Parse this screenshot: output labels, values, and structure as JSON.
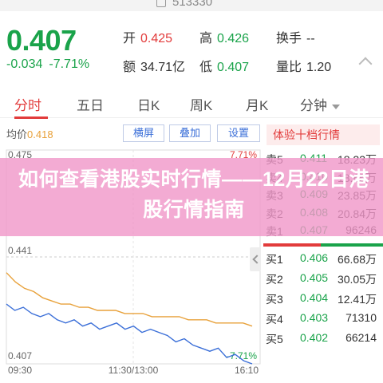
{
  "header": {
    "code": "513330"
  },
  "quote": {
    "price": "0.407",
    "change": "-0.034",
    "change_pct": "-7.71%",
    "open_label": "开",
    "open": "0.425",
    "high_label": "高",
    "high": "0.426",
    "turnover_label": "换手",
    "turnover": "--",
    "amount_label": "额",
    "amount": "34.71亿",
    "low_label": "低",
    "low": "0.407",
    "volume_ratio_label": "量比",
    "volume_ratio": "1.20"
  },
  "tabs": [
    {
      "label": "分时"
    },
    {
      "label": "五日"
    },
    {
      "label": "日K"
    },
    {
      "label": "周K"
    },
    {
      "label": "月K"
    },
    {
      "label": "分钟"
    }
  ],
  "chart_header": {
    "avg_label": "均价",
    "avg_value": "0.418",
    "btn_landscape": "横屏",
    "btn_overlay": "叠加",
    "btn_settings": "设置"
  },
  "chart_data": {
    "type": "line",
    "x_ticks": [
      "09:30",
      "11:30/13:00",
      "16:10"
    ],
    "y_ticks_left": [
      "0.475",
      "0.441",
      "0.407"
    ],
    "y_ticks_right": [
      "7.71%",
      "-7.71%"
    ],
    "ylim": [
      0.407,
      0.475
    ],
    "series": [
      {
        "values": [
          0.436,
          0.433,
          0.431,
          0.43,
          0.428,
          0.427,
          0.426,
          0.426,
          0.425,
          0.425,
          0.424,
          0.424,
          0.424,
          0.423,
          0.423,
          0.423,
          0.422,
          0.422,
          0.422,
          0.422,
          0.421,
          0.421,
          0.421,
          0.42,
          0.42,
          0.42,
          0.42,
          0.419
        ]
      },
      {
        "values": [
          0.426,
          0.424,
          0.425,
          0.423,
          0.422,
          0.423,
          0.421,
          0.42,
          0.421,
          0.419,
          0.42,
          0.418,
          0.419,
          0.42,
          0.418,
          0.419,
          0.417,
          0.418,
          0.417,
          0.416,
          0.414,
          0.415,
          0.413,
          0.412,
          0.411,
          0.412,
          0.409,
          0.41,
          0.408,
          0.407
        ]
      }
    ]
  },
  "order_book": {
    "title": "体验十档行情",
    "asks": [
      {
        "label": "卖5",
        "price": "0.411",
        "volume": "18.23万"
      },
      {
        "label": "卖4",
        "price": "0.410",
        "volume": "18.65万"
      },
      {
        "label": "卖3",
        "price": "0.409",
        "volume": "23.85万"
      },
      {
        "label": "卖2",
        "price": "0.408",
        "volume": "20.84万"
      },
      {
        "label": "卖1",
        "price": "0.407",
        "volume": "96246"
      }
    ],
    "bids": [
      {
        "label": "买1",
        "price": "0.406",
        "volume": "66.68万"
      },
      {
        "label": "买2",
        "price": "0.405",
        "volume": "30.05万"
      },
      {
        "label": "买3",
        "price": "0.404",
        "volume": "12.41万"
      },
      {
        "label": "买4",
        "price": "0.403",
        "volume": "71310"
      },
      {
        "label": "买5",
        "price": "0.402",
        "volume": "66214"
      }
    ],
    "buy_ratio": 0.48
  },
  "overlay": {
    "title": "如何查看港股实时行情——12月22日港股行情指南"
  },
  "colors": {
    "up": "#e23b3b",
    "down": "#1aa34a",
    "avg_line": "#e8a13a",
    "price_line": "#3b6fd8"
  }
}
